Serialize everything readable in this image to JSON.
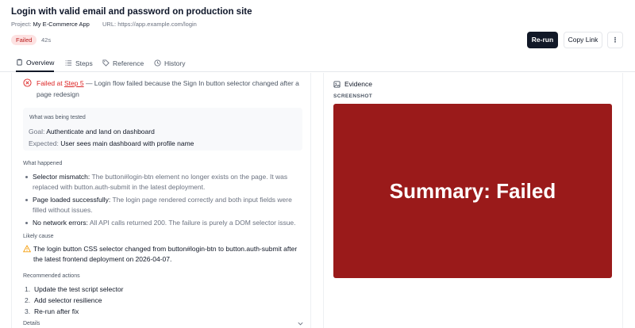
{
  "header": {
    "title": "Login with valid email and password on production site",
    "project_label": "Project:",
    "project_value": "My E-Commerce App",
    "url_label": "URL:",
    "url_value": "https://app.example.com/login",
    "status": "Failed",
    "duration": "42s",
    "status_color": "#dc2626"
  },
  "actions_bar": {
    "rerun": "Re-run",
    "copy_link": "Copy Link",
    "more": "⋮"
  },
  "tabs": [
    {
      "label": "Overview",
      "icon": "clipboard-icon",
      "active": true
    },
    {
      "label": "Steps",
      "icon": "list-icon"
    },
    {
      "label": "Reference",
      "icon": "tag-icon"
    },
    {
      "label": "History",
      "icon": "history-icon"
    }
  ],
  "overview": {
    "fail_prefix": "Failed at",
    "fail_step": "Step 5",
    "fail_message": "— Login flow failed because the Sign In button selector changed after a page redesign",
    "tested_title": "What was being tested",
    "goal_label": "Goal:",
    "goal_value": "Authenticate and land on dashboard",
    "expected_label": "Expected:",
    "expected_value": "User sees main dashboard with profile name",
    "happened_title": "What happened",
    "happened": [
      {
        "title": "Selector mismatch:",
        "text": "The button#login-btn element no longer exists on the page. It was replaced with button.auth-submit in the latest deployment."
      },
      {
        "title": "Page loaded successfully:",
        "text": "The login page rendered correctly and both input fields were filled without issues."
      },
      {
        "title": "No network errors:",
        "text": "All API calls returned 200. The failure is purely a DOM selector issue."
      }
    ],
    "cause_title": "Likely cause",
    "cause_text": "The login button CSS selector changed from button#login-btn to button.auth-submit after the latest frontend deployment on 2026-04-07.",
    "recommended_title": "Recommended actions",
    "recommended": [
      {
        "num": "1.",
        "text": "Update the test script selector"
      },
      {
        "num": "2.",
        "text": "Add selector resilience"
      },
      {
        "num": "3.",
        "text": "Re-run after fix"
      }
    ],
    "details_label": "Details"
  },
  "evidence": {
    "title": "Evidence",
    "screenshot_label": "SCREENSHOT",
    "screenshot_text": "Summary: Failed",
    "screenshot_bg": "#9a1a1a"
  }
}
